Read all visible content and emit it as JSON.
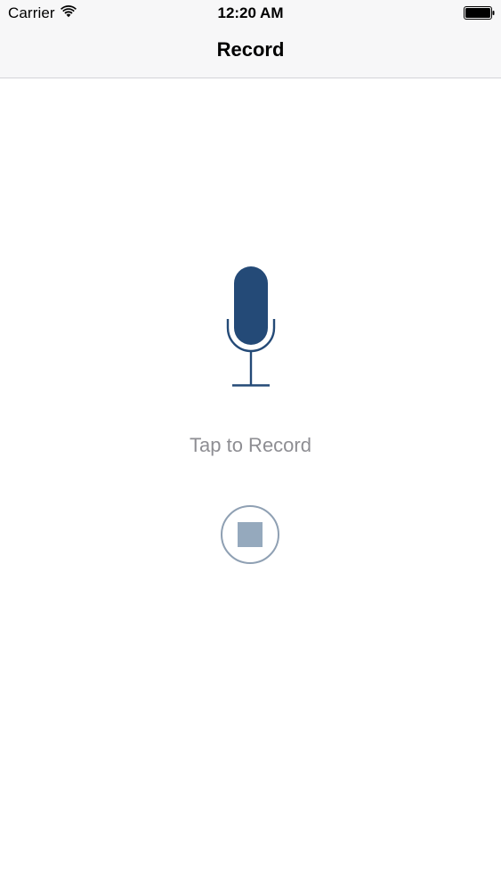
{
  "status_bar": {
    "carrier": "Carrier",
    "time": "12:20 AM",
    "wifi_icon": "wifi-icon",
    "battery_icon": "battery-icon"
  },
  "nav": {
    "title": "Record"
  },
  "recorder": {
    "mic_icon": "microphone-icon",
    "hint": "Tap to Record",
    "stop_icon": "stop-icon"
  },
  "colors": {
    "mic": "#244a77",
    "stop_fill": "#95a9bd",
    "stop_ring": "#8fa0b3",
    "hint_text": "#8e8e93",
    "bar_background": "#f7f7f8"
  }
}
